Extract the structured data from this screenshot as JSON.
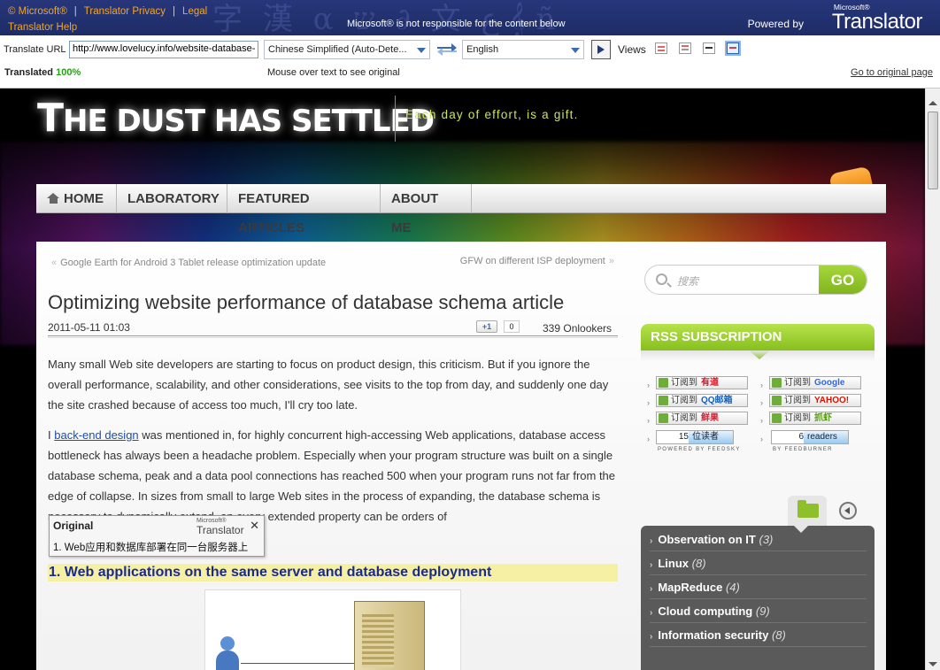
{
  "translator_bar": {
    "ms_copyright": "© Microsoft®",
    "privacy_link": "Translator Privacy",
    "legal_link": "Legal",
    "help_link": "Translator Help",
    "disclaimer": "Microsoft® is not responsible for the content below",
    "powered_by": "Powered by",
    "brand_small": "Microsoft®",
    "brand_big": "Translator"
  },
  "controls": {
    "translate_url_label": "Translate URL",
    "url_value": "http://www.lovelucy.info/website-database-",
    "from_language": "Chinese Simplified (Auto-Dete...",
    "to_language": "English",
    "views_label": "Views",
    "translated_label": "Translated",
    "translated_pct": "100%",
    "mouseover_hint": "Mouse over text to see original",
    "original_link": "Go to original page"
  },
  "site": {
    "title_first": "T",
    "title_rest": "HE DUST HAS SETTLED",
    "tagline": "Each day of effort, is a gift.",
    "nav": [
      "HOME",
      "LABORATORY",
      "FEATURED ARTICLES",
      "ABOUT ME"
    ]
  },
  "post": {
    "prev_mark": "«",
    "prev_title": "Google Earth for Android 3 Tablet release optimization update",
    "next_title": "GFW on different ISP deployment",
    "next_mark": "»",
    "title": "Optimizing website performance of database schema article",
    "date": "2011-05-11 01:03",
    "plus_one": "+1",
    "plus_one_count": "0",
    "onlookers": "339 Onlookers",
    "para1": "Many small Web site developers are starting to focus on product design, this criticism. But if you ignore the overall performance, scalability, and other considerations, see visits to the top from day, and suddenly one day the site crashed because of access too much, I'll cry too late.",
    "para2_lead": "I",
    "para2_link": "back-end design",
    "para2_rest": "was mentioned in, for highly concurrent high-accessing Web applications, database access bottleneck has always been a headache problem. Especially when your program structure was built on a single database schema, peak and a data pool connections has reached 500 when your program runs not far from the edge of collapse. In sizes from small to large Web sites in the process of expanding, the database schema is necessary to dynamically extend, on every extended property can be orders of",
    "section_heading": "1. Web applications on the same server and database deployment"
  },
  "tooltip": {
    "title": "Original",
    "brand_small": "Microsoft®",
    "brand_big": "Translator",
    "close": "✕",
    "original_text": "1. Web应用和数据库部署在同一台服务器上"
  },
  "sidebar": {
    "search_placeholder": "搜索",
    "search_go": "GO",
    "rss_title": "RSS SUBSCRIPTION",
    "sub_left": [
      {
        "prefix": "订阅到",
        "service": "有道"
      },
      {
        "prefix": "订阅到",
        "service": "QQ邮箱"
      },
      {
        "prefix": "订阅到",
        "service": "鲜果"
      }
    ],
    "sub_right": [
      {
        "prefix": "订阅到",
        "service": "Google"
      },
      {
        "prefix": "订阅到",
        "service": "YAHOO!"
      },
      {
        "prefix": "订阅到",
        "service": "抓虾"
      }
    ],
    "feedsky_count": "15",
    "feedsky_unit": "位读者",
    "feedsky_credit": "POWERED BY FEEDSKY",
    "feedburner_count": "6",
    "feedburner_unit": "readers",
    "feedburner_credit": "BY FEEDBURNER",
    "categories": [
      {
        "name": "Observation on IT",
        "count": "(3)"
      },
      {
        "name": "Linux",
        "count": "(8)"
      },
      {
        "name": "MapReduce",
        "count": "(4)"
      },
      {
        "name": "Cloud computing",
        "count": "(9)"
      },
      {
        "name": "Information security",
        "count": "(8)"
      }
    ]
  }
}
